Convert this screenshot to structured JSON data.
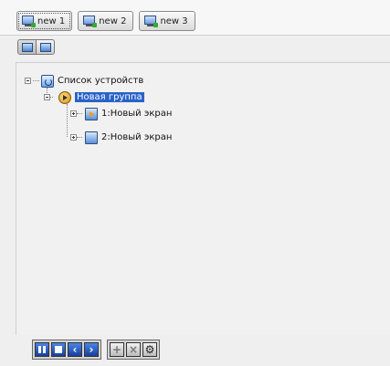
{
  "toolbar": {
    "tabs": [
      {
        "label": "new 1",
        "icon": "monitor-add-icon"
      },
      {
        "label": "new 2",
        "icon": "monitor-add-icon"
      },
      {
        "label": "new 3",
        "icon": "monitor-add-icon"
      }
    ]
  },
  "view_switch": {
    "items": [
      {
        "icon": "single-monitor-icon",
        "selected": true
      },
      {
        "icon": "monitor-icon",
        "selected": false
      }
    ]
  },
  "tree": {
    "root": {
      "label": "Список устройств",
      "icon": "device-list-icon",
      "expanded": true
    },
    "group": {
      "label": "Новая группа",
      "icon": "group-icon",
      "expanded": true,
      "selected": true
    },
    "screens": [
      {
        "label": "1:Новый экран",
        "icon": "screen-play-icon",
        "expanded": false
      },
      {
        "label": "2:Новый экран",
        "icon": "screen-icon",
        "expanded": false
      }
    ]
  },
  "controls": {
    "playback": [
      "pause-icon",
      "stop-icon",
      "previous-icon",
      "next-icon"
    ],
    "edit": [
      "add-icon",
      "delete-icon",
      "settings-icon"
    ]
  },
  "colors": {
    "selection": "#2a63c8",
    "playback_blue": "#2456c0"
  }
}
